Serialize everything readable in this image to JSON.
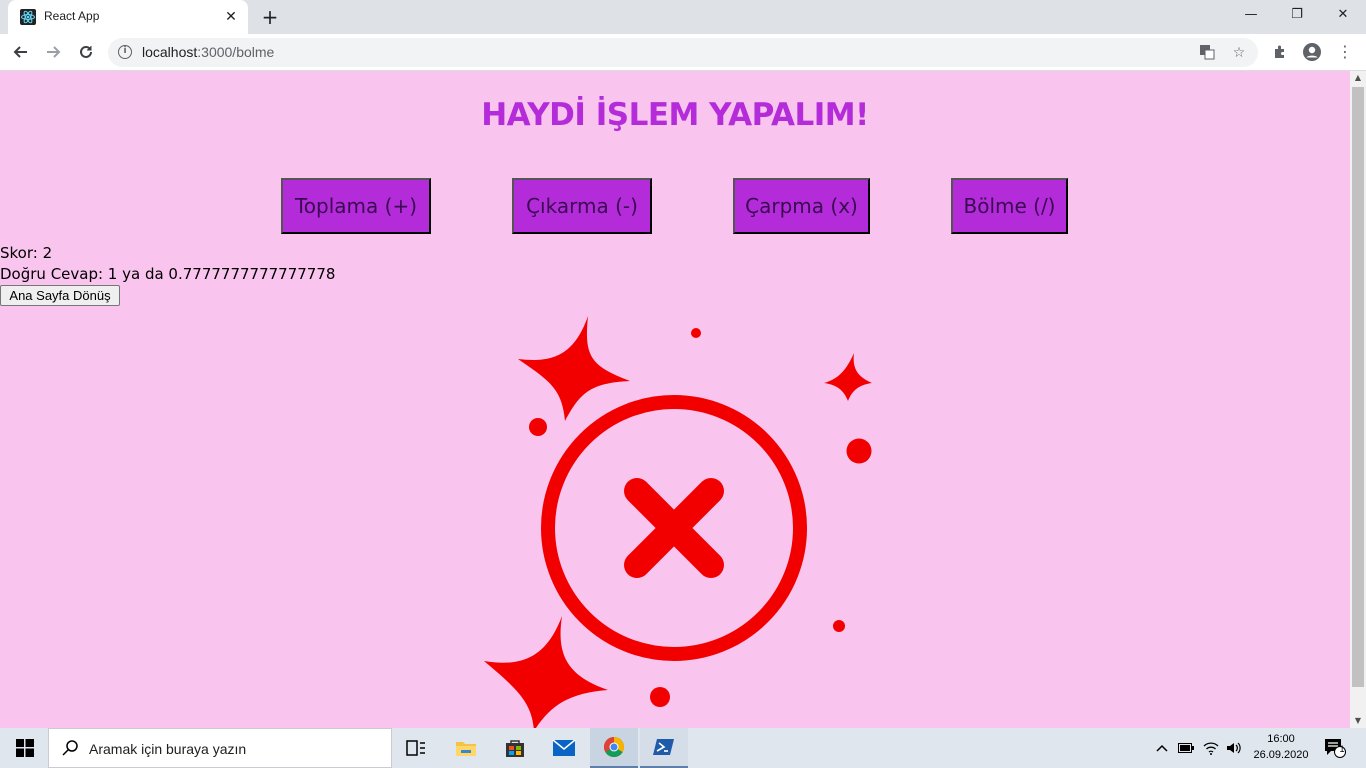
{
  "browser": {
    "tab_title": "React App",
    "tab_close": "✕",
    "new_tab": "+",
    "url_host": "localhost",
    "url_path": ":3000/bolme",
    "window_controls": {
      "minimize": "—",
      "restore": "❐",
      "close": "✕"
    }
  },
  "page": {
    "heading": "HAYDİ İŞLEM YAPALIM!",
    "operations": [
      {
        "label": "Toplama (+)"
      },
      {
        "label": "Çıkarma (-)"
      },
      {
        "label": "Çarpma (x)"
      },
      {
        "label": "Bölme (/)"
      }
    ],
    "score": "Skor: 2",
    "correct_answer": "Doğru Cevap: 1 ya da 0.7777777777777778",
    "home_button": "Ana Sayfa Dönüş",
    "colors": {
      "background": "#f9c4ee",
      "accent": "#b42bd9",
      "wrong_icon": "#f20000"
    }
  },
  "taskbar": {
    "search_placeholder": "Aramak için buraya yazın",
    "time": "16:00",
    "date": "26.09.2020",
    "notification_count": "1"
  }
}
